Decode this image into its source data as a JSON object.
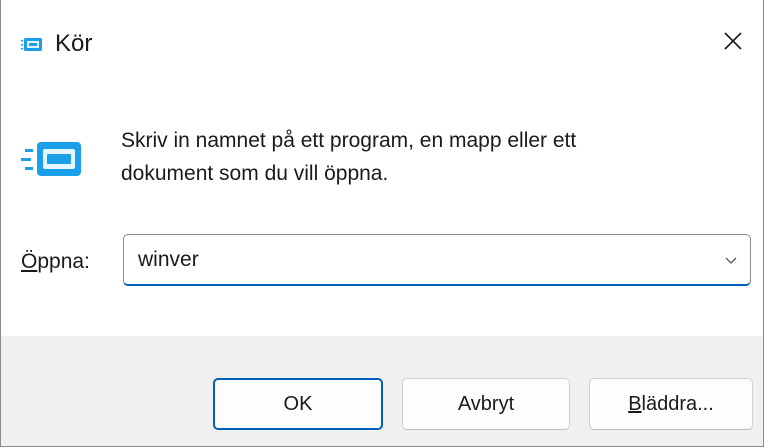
{
  "window": {
    "title": "Kör",
    "icon": "run-icon"
  },
  "content": {
    "description_line1": "Skriv in namnet på ett program, en mapp eller ett",
    "description_line2": "dokument som du vill öppna.",
    "open_label_mnemonic": "Ö",
    "open_label_rest": "ppna:",
    "open_value": "winver"
  },
  "buttons": {
    "ok": "OK",
    "cancel": "Avbryt",
    "browse_mnemonic": "B",
    "browse_rest": "läddra..."
  },
  "colors": {
    "accent": "#005fb8",
    "footer_bg": "#f0f0f0",
    "icon_blue": "#1aa0e8"
  }
}
